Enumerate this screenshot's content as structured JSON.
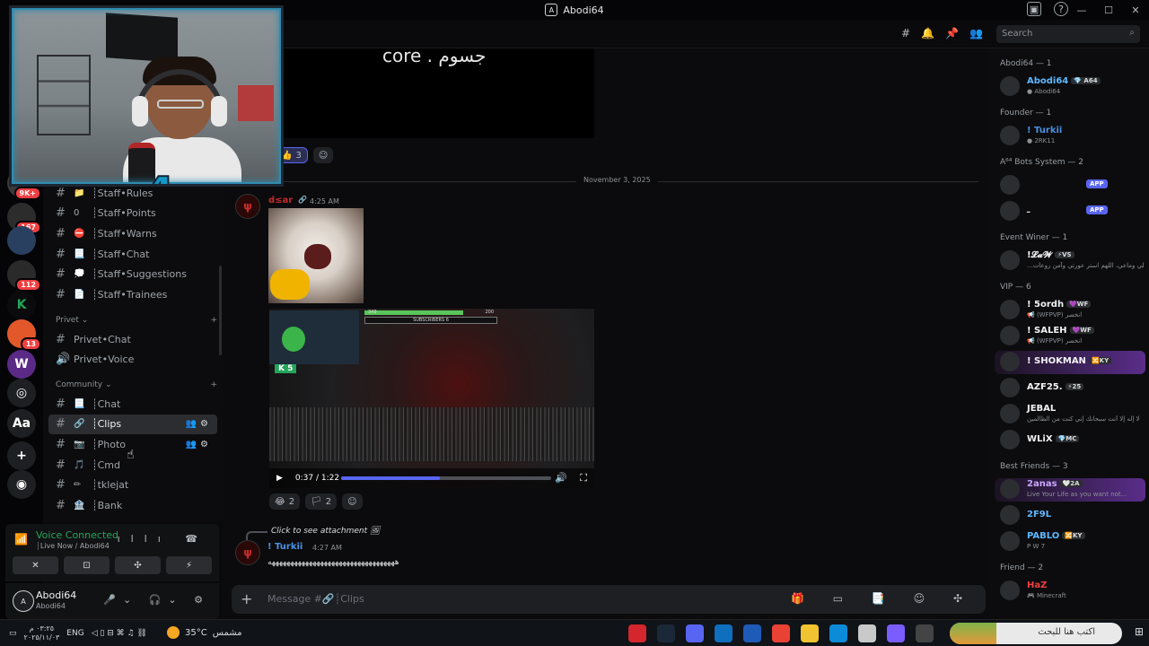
{
  "window": {
    "title": "Abodi64",
    "controls": [
      "—",
      "☐",
      "✕"
    ],
    "title_icons": [
      "▣",
      "?"
    ]
  },
  "rail": {
    "servers": [
      {
        "name": "server-9k",
        "badge": "9K+",
        "color": "#3a3a3a"
      },
      {
        "name": "server-167",
        "badge": "167",
        "color": "#2c2c2c"
      },
      {
        "name": "server-blue",
        "badge": "",
        "color": "#2a4060"
      },
      {
        "name": "server-112",
        "badge": "112",
        "color": "#2a2a2a"
      },
      {
        "name": "server-k",
        "badge": "",
        "color": "#0b0b0d",
        "glyph": "K"
      },
      {
        "name": "server-13",
        "badge": "13",
        "color": "#e2582b"
      },
      {
        "name": "server-wf",
        "badge": "",
        "color": "#5b2a86",
        "glyph": "W"
      },
      {
        "name": "server-ring",
        "badge": "",
        "color": "#1e1f22",
        "glyph": "◎"
      },
      {
        "name": "server-font",
        "badge": "",
        "color": "#1e1f22",
        "glyph": "Aa"
      },
      {
        "name": "add-server",
        "badge": "",
        "color": "#1e1f22",
        "glyph": "+"
      },
      {
        "name": "discover",
        "badge": "",
        "color": "#1e1f22",
        "glyph": "◉"
      }
    ]
  },
  "sidebar": {
    "channels_top": [
      {
        "emoji": "📁",
        "label": "┊Staff•Rules"
      },
      {
        "emoji": "0",
        "label": "┊Staff•Points"
      },
      {
        "emoji": "⛔",
        "label": "┊Staff•Warns"
      },
      {
        "emoji": "📃",
        "label": "┊Staff•Chat"
      },
      {
        "emoji": "💭",
        "label": "┊Staff•Suggestions"
      },
      {
        "emoji": "📄",
        "label": "┊Staff•Trainees"
      }
    ],
    "cat_privet": "Privet ⌄",
    "privet": [
      {
        "emoji": "",
        "label": "Privet•Chat",
        "hash": "#"
      },
      {
        "emoji": "",
        "label": "Privet•Voice",
        "hash": "🔊"
      }
    ],
    "cat_community": "Community ⌄",
    "community": [
      {
        "emoji": "📃",
        "label": "┊Chat"
      },
      {
        "emoji": "🔗",
        "label": "┊Clips",
        "selected": true
      },
      {
        "emoji": "📷",
        "label": "┊Photo"
      },
      {
        "emoji": "🎵",
        "label": "┊Cmd"
      },
      {
        "emoji": "✏",
        "label": "┊tklejat"
      },
      {
        "emoji": "🏦",
        "label": "┊Bank"
      }
    ],
    "ops": "👥⚙"
  },
  "voice": {
    "status": "Voice Connected",
    "channel": "┊Live Now / Abodi64",
    "icons": "ıllı ☎",
    "buttons": [
      "✕",
      "⊡",
      "✣",
      "⚡"
    ]
  },
  "user": {
    "name": "Abodi64",
    "sub": "Abodi64",
    "controls": "🎤⌄ 🎧⌄ ⚙"
  },
  "header": {
    "icons": [
      "#",
      "🔔",
      "📌",
      "👥"
    ],
    "search_placeholder": "Search"
  },
  "chat": {
    "top_caption": "core . جسوم",
    "reactions_1": [
      {
        "emoji": "👍",
        "count": "3",
        "on": true
      },
      {
        "emoji": "☺",
        "count": ""
      }
    ],
    "date_divider": "November 3, 2025",
    "msg1": {
      "author": "d≤ar",
      "time": "4:25 AM",
      "badge": "🔗"
    },
    "video": {
      "time": "0:37 / 1:22",
      "progress": 0.47,
      "subscribers_label": "SUBSCRIBERS",
      "sub_left": "349",
      "sub_right": "200",
      "sub_count": "6",
      "k5": "K 5"
    },
    "reactions_2": [
      {
        "emoji": "😂",
        "count": "2"
      },
      {
        "emoji": "🏳",
        "count": "2"
      },
      {
        "emoji": "☺",
        "count": ""
      }
    ],
    "reply": {
      "text": "Click to see attachment 🖼"
    },
    "msg2": {
      "author": "! Turkii",
      "time": "4:27 AM",
      "text": "ههههههههههههههههههههههههههههههههههه"
    }
  },
  "composer": {
    "placeholder": "Message #🔗┊Clips",
    "tools": "🎁 ▭ 📑 ☺ ✣"
  },
  "members": {
    "groups": [
      {
        "title": "Abodi64 — 1",
        "members": [
          {
            "name": "Abodi64",
            "tag": "💎 A64",
            "sub": "● Abodi64",
            "color": "#5eb8ff"
          }
        ]
      },
      {
        "title": "Founder — 1",
        "members": [
          {
            "name": "! Turkii",
            "sub": "● 2RK11",
            "color": "#4a90e2"
          }
        ]
      },
      {
        "title": "A⁶⁴ Bots System — 2",
        "members": [
          {
            "name": "",
            "sub": "",
            "app": "APP",
            "color": "#dbdee1"
          },
          {
            "name": "ـ",
            "sub": "",
            "app": "APP",
            "color": "#dbdee1"
          }
        ]
      },
      {
        "title": "Event Winer — 1",
        "members": [
          {
            "name": "!𝓛𝓪𝓦",
            "tag": "⚡VS",
            "sub": "...وأهلي وماعي، اللهم استر عورتي وآمن روعات",
            "color": "#f2f3f5"
          }
        ]
      },
      {
        "title": "VIP — 6",
        "members": [
          {
            "name": "! 5ordh",
            "tag": "💜WF",
            "sub": "📢 (WFPVP) انخصر",
            "color": "#f2f3f5"
          },
          {
            "name": "! SALEH",
            "tag": "💜WF",
            "sub": "📢 (WFPVP) انخصر",
            "color": "#f2f3f5"
          },
          {
            "name": "! SHOKMAN",
            "tag": "🔀KY",
            "sub": "",
            "color": "#f2f3f5",
            "hl": true
          },
          {
            "name": "AZF25.",
            "tag": "⚡25",
            "sub": "",
            "color": "#f2f3f5"
          },
          {
            "name": "JEBAL",
            "sub": "لا إله إلا أنت سبحانك إني كنت من الظالمين",
            "color": "#f2f3f5"
          },
          {
            "name": "WLiX",
            "tag": "💎MC",
            "sub": "",
            "color": "#f2f3f5"
          }
        ]
      },
      {
        "title": "Best Friends — 3",
        "members": [
          {
            "name": "2anas",
            "tag": "🤍2A",
            "sub": "Live Your Life as you want not...",
            "color": "#c9a7ff",
            "hl": true
          },
          {
            "name": "2F9L",
            "sub": "",
            "color": "#5eb8ff"
          },
          {
            "name": "PABLO",
            "tag": "🔀KY",
            "sub": "P W 7",
            "color": "#5eb8ff"
          }
        ]
      },
      {
        "title": "Friend — 2",
        "members": [
          {
            "name": "HaZ",
            "sub": "🎮 Minecraft",
            "color": "#f23f42"
          }
        ]
      }
    ]
  },
  "taskbar": {
    "time": "٠٣:٢٥ م",
    "date": "٢٠٢٥/١١/٠٣",
    "lang": "ENG",
    "weather_temp": "35°C",
    "weather_desc": "مشمس",
    "search": "اكتب هنا للبحث",
    "tray": "◁ ▯ ⊟ ⌘ ♫ ⛓",
    "start": "⊞"
  }
}
